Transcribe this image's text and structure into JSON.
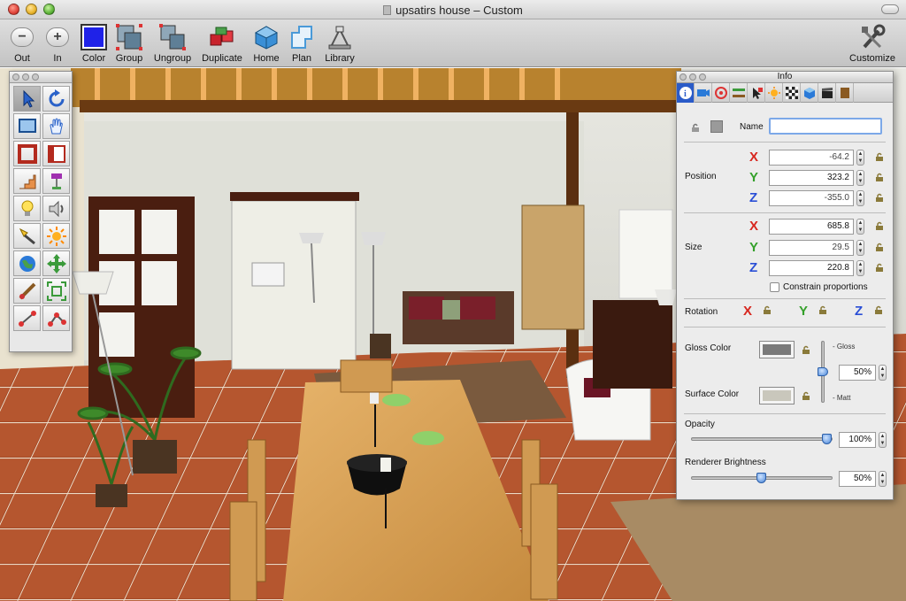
{
  "window": {
    "title": "upsatirs house – Custom"
  },
  "toolbar": {
    "items": [
      {
        "label": "Out",
        "icon": "zoom-out-icon"
      },
      {
        "label": "In",
        "icon": "zoom-in-icon"
      },
      {
        "label": "Color",
        "icon": "color-swatch-icon"
      },
      {
        "label": "Group",
        "icon": "group-icon"
      },
      {
        "label": "Ungroup",
        "icon": "ungroup-icon"
      },
      {
        "label": "Duplicate",
        "icon": "duplicate-icon"
      },
      {
        "label": "Home",
        "icon": "home-icon"
      },
      {
        "label": "Plan",
        "icon": "plan-icon"
      },
      {
        "label": "Library",
        "icon": "library-icon"
      }
    ],
    "customize_label": "Customize",
    "color_value": "#1f22e8"
  },
  "info_panel": {
    "title": "Info",
    "name_label": "Name",
    "name_value": "",
    "position": {
      "label": "Position",
      "x": "-64.2",
      "y": "323.2",
      "z": "-355.0"
    },
    "size": {
      "label": "Size",
      "x": "685.8",
      "y": "29.5",
      "z": "220.8"
    },
    "axis_labels": {
      "x": "X",
      "y": "Y",
      "z": "Z"
    },
    "constrain_label": "Constrain proportions",
    "rotation_label": "Rotation",
    "gloss_color_label": "Gloss Color",
    "surface_color_label": "Surface Color",
    "gloss_label": "Gloss",
    "matt_label": "Matt",
    "gloss_value": "50%",
    "opacity_label": "Opacity",
    "opacity_value": "100%",
    "brightness_label": "Renderer Brightness",
    "brightness_value": "50%",
    "gloss_color": "#7a7a7a",
    "surface_color": "#c9c7bc"
  }
}
